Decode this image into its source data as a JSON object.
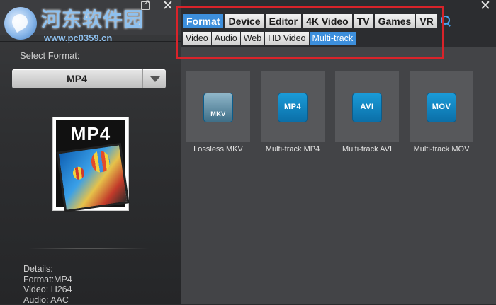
{
  "watermark": {
    "title": "河东软件园",
    "url": "www.pc0359.cn"
  },
  "left": {
    "select_label": "Select Format:",
    "selected_format": "MP4",
    "thumbnail_title": "MP4",
    "details": {
      "heading": "Details:",
      "format": "Format:MP4",
      "video": "Video: H264",
      "audio": "Audio: AAC"
    }
  },
  "main_tabs": [
    "Format",
    "Device",
    "Editor",
    "4K Video",
    "TV",
    "Games",
    "VR"
  ],
  "active_main_tab": "Format",
  "sub_tabs": [
    "Video",
    "Audio",
    "Web",
    "HD Video",
    "Multi-track"
  ],
  "active_sub_tab": "Multi-track",
  "formats": [
    {
      "icon_text": "MKV",
      "label": "Lossless MKV"
    },
    {
      "icon_text": "MP4",
      "label": "Multi-track MP4"
    },
    {
      "icon_text": "AVI",
      "label": "Multi-track AVI"
    },
    {
      "icon_text": "MOV",
      "label": "Multi-track MOV"
    }
  ],
  "colors": {
    "accent": "#3d8fdc",
    "highlight": "#d9232a"
  }
}
